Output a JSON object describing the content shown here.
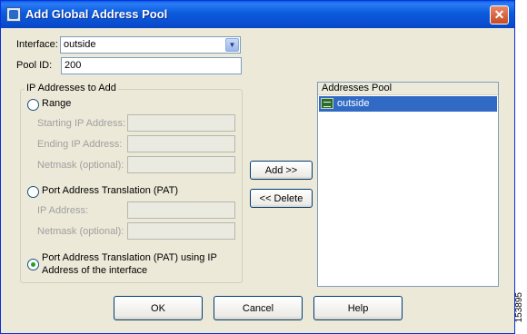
{
  "window": {
    "title": "Add Global Address Pool",
    "close_glyph": "✕"
  },
  "interface": {
    "label": "Interface:",
    "value": "outside"
  },
  "pool_id": {
    "label": "Pool ID:",
    "value": "200"
  },
  "ip_group": {
    "title": "IP Addresses to Add",
    "range": {
      "label": "Range",
      "starting_ip_label": "Starting IP Address:",
      "ending_ip_label": "Ending IP Address:",
      "netmask_label": "Netmask (optional):"
    },
    "pat": {
      "label": "Port Address Translation (PAT)",
      "ip_label": "IP Address:",
      "netmask_label": "Netmask (optional):"
    },
    "pat_interface": {
      "label_line1": "Port Address Translation (PAT) using IP",
      "label_line2": "Address of the interface",
      "selected": true
    }
  },
  "actions": {
    "add": "Add >>",
    "delete": "<< Delete"
  },
  "addresses_pool": {
    "header": "Addresses Pool",
    "items": [
      {
        "label": "outside",
        "icon": "network-interface-icon"
      }
    ]
  },
  "footer": {
    "ok": "OK",
    "cancel": "Cancel",
    "help": "Help"
  },
  "figure_id": "153895",
  "colors": {
    "title_bar": "#0a55d9",
    "selection": "#316ac5",
    "dialog_bg": "#ece9d8",
    "radio_selected": "#21a121"
  }
}
